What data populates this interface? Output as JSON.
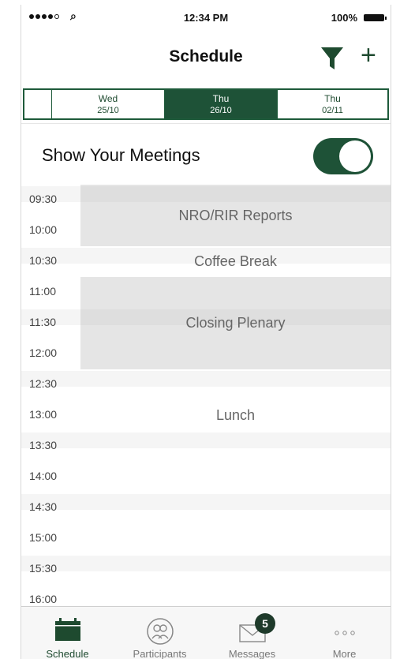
{
  "status_bar": {
    "time": "12:34 PM",
    "battery": "100%"
  },
  "nav": {
    "title": "Schedule"
  },
  "dates": [
    {
      "day": "Wed",
      "date": "25/10",
      "active": false
    },
    {
      "day": "Thu",
      "date": "26/10",
      "active": true
    },
    {
      "day": "Thu",
      "date": "02/11",
      "active": false
    }
  ],
  "meetings_toggle": {
    "label": "Show Your Meetings",
    "on": true
  },
  "time_slots": [
    "09:30",
    "10:00",
    "10:30",
    "11:00",
    "11:30",
    "12:00",
    "12:30",
    "13:00",
    "13:30",
    "14:00",
    "14:30",
    "15:00",
    "15:30",
    "16:00"
  ],
  "events": [
    {
      "title": "NRO/RIR Reports",
      "start": "09:30",
      "end": "10:30"
    },
    {
      "title": "Coffee Break",
      "start": "10:30",
      "end": "11:00"
    },
    {
      "title": "Closing Plenary",
      "start": "11:00",
      "end": "12:30"
    },
    {
      "title": "Lunch",
      "start": "12:30",
      "end": "14:00"
    }
  ],
  "tabs": [
    {
      "label": "Schedule",
      "icon": "calendar-icon",
      "active": true
    },
    {
      "label": "Participants",
      "icon": "participants-icon",
      "active": false
    },
    {
      "label": "Messages",
      "icon": "envelope-icon",
      "active": false,
      "badge": "5"
    },
    {
      "label": "More",
      "icon": "more-icon",
      "active": false
    }
  ],
  "colors": {
    "accent": "#1e5237",
    "event_fill": "#d9d9d9"
  }
}
